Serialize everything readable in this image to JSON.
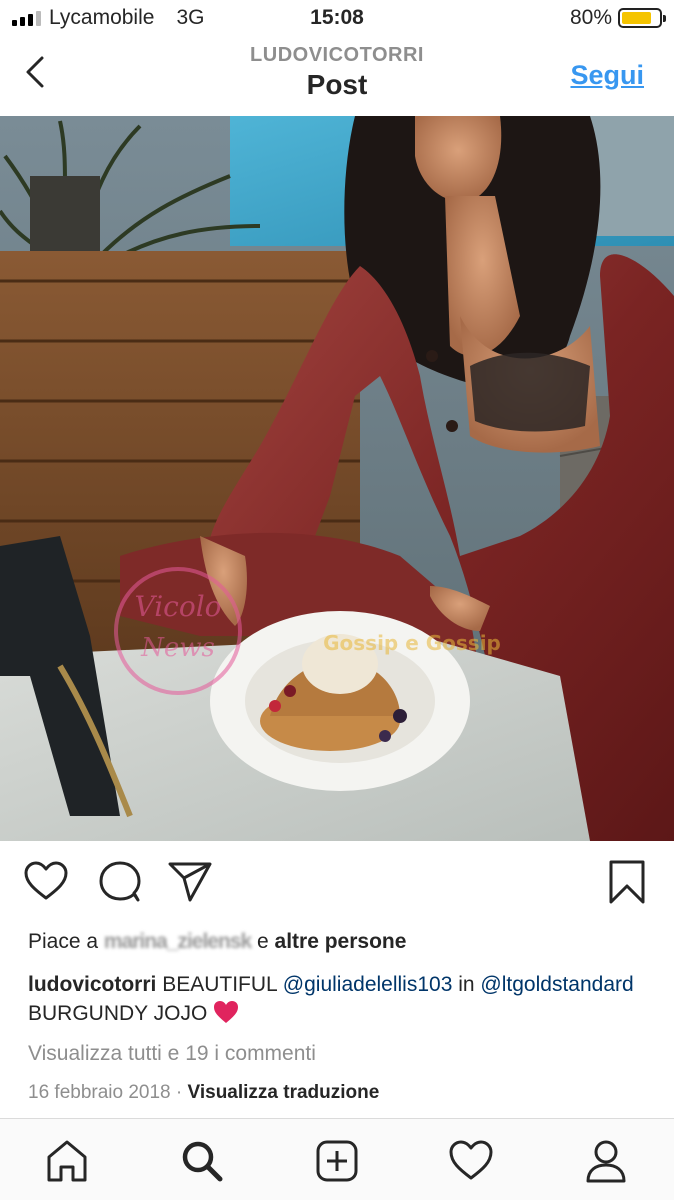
{
  "status_bar": {
    "carrier": "Lycamobile",
    "network": "3G",
    "time": "15:08",
    "battery_percent": "80%",
    "battery_level": 0.8,
    "battery_color": "#f5c400"
  },
  "header": {
    "username": "LUDOVICOTORRI",
    "title": "Post",
    "follow_label": "Segui",
    "back_icon": "chevron-left-icon"
  },
  "post": {
    "image_description_icon": "photo",
    "watermark_1": "Vicolo delle News",
    "watermark_2": "Gossip e Gossip"
  },
  "actions": {
    "like_icon": "heart-outline-icon",
    "comment_icon": "comment-bubble-icon",
    "share_icon": "paper-plane-icon",
    "save_icon": "bookmark-icon"
  },
  "likes": {
    "prefix": "Piace a",
    "blurred_name": "marina_zielensk",
    "suffix": "e",
    "others": "altre persone"
  },
  "caption": {
    "username": "ludovicotorri",
    "text_1": "BEAUTIFUL",
    "mention_1": "@giuliadelellis103",
    "text_2": "in",
    "mention_2": "@ltgoldstandard",
    "text_3": "BURGUNDY JOJO"
  },
  "comments": {
    "view_all": "Visualizza tutti e 19 i commenti"
  },
  "meta": {
    "date": "16 febbraio 2018",
    "separator": "·",
    "translate": "Visualizza traduzione"
  },
  "tab_bar": {
    "items": [
      "home-icon",
      "search-icon",
      "new-post-icon",
      "activity-heart-icon",
      "profile-icon"
    ]
  },
  "colors": {
    "link_blue": "#3897f0",
    "mention_blue": "#003569",
    "secondary_gray": "#8e8e8e",
    "emoji_red": "#e0245e"
  }
}
